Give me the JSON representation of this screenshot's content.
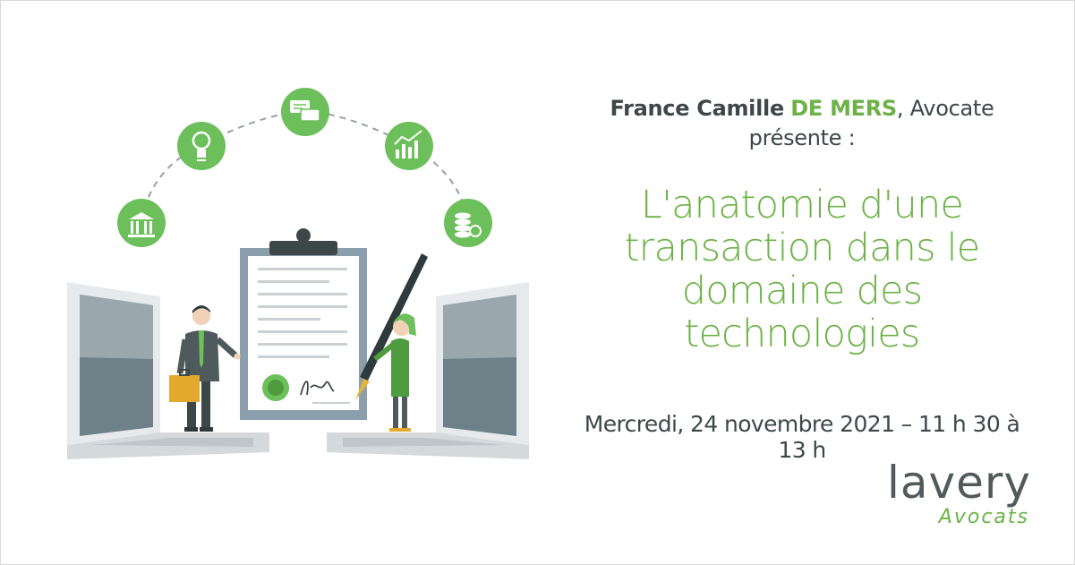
{
  "presenter": {
    "first_name": "France Camille",
    "last_name": "DE MERS",
    "role": ", Avocate",
    "verb": "présente :"
  },
  "title_lines": [
    "L'anatomie d'une",
    "transaction dans le",
    "domaine des",
    "technologies"
  ],
  "event_date": "Mercredi, 24 novembre 2021 – 11 h 30 à 13 h",
  "logo": {
    "wordmark": "lavery",
    "subline": "Avocats"
  },
  "icons": [
    "bank-icon",
    "lightbulb-icon",
    "chat-icon",
    "bar-chart-icon",
    "coins-icon"
  ],
  "colors": {
    "accent_green": "#6cb246",
    "dark_text": "#3e4748",
    "logo_gray": "#525a5c"
  }
}
